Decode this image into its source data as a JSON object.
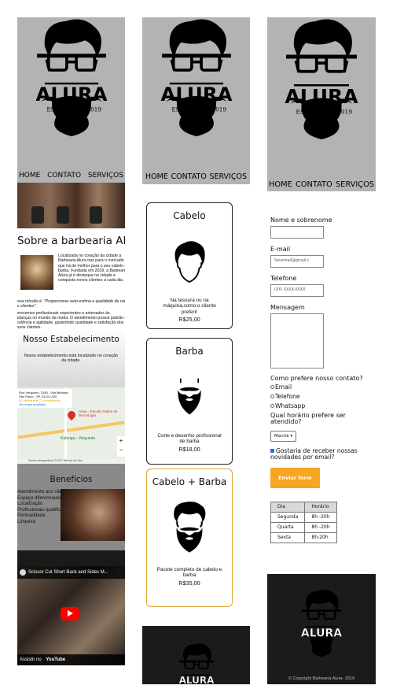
{
  "logo": {
    "brand": "ALURA",
    "estd": "ESTD",
    "year": "2019"
  },
  "nav": {
    "home": "HOME",
    "contato": "CONTATO",
    "servicos": "SERVIÇOS"
  },
  "about": {
    "title": "Sobre a barbearia Alura",
    "p1": "Localizada no coração da cidade a Barbearia Alura traz para o mercado o que há de melhor para o seu cabelo e barba. Fundada em 2019, a Barbearia Alura já é destaque na cidade e conquista novos clientes a cada dia.",
    "mission": "Nossa missão é: \"Proporcionar auto-estima e qualidade de vida aos clientes\".",
    "p2": "Oferecemos profissionais experientes e antenados às mudanças no mundo da moda. O atendimento possui padrão de excelência e agilidade, garantindo qualidade e satisfação dos nossos clientes."
  },
  "establishment": {
    "title": "Nosso Estabelecimento",
    "text": "Nosso estabelecimento está localizado no coração da cidade."
  },
  "map": {
    "address": "Rua Vergueiro, 3185 - Vila Mariana, São Paulo - SP, 04101-300",
    "rating": "5,0 ★★★★★  71 comentários",
    "link": "Ver mapa ampliado",
    "place": "Alura - Escola Online de Tecnologia",
    "station": "Kalunga - Vergueiro",
    "zoom_in": "+",
    "zoom_out": "−",
    "footer": "Dados cartográficos ©2021  Termos de Uso"
  },
  "benefits": {
    "title": "Benefícios",
    "items": [
      "Atendimento aos clientes",
      "Espaço diferenciado",
      "Localização",
      "Profissionais qualificados",
      "Pontualidade",
      "Limpeza"
    ]
  },
  "video": {
    "title": "Scissor Cut Short Back and Sides M...",
    "watch": "Assistir no",
    "platform": "YouTube"
  },
  "services": [
    {
      "name": "Cabelo",
      "desc": "Na tesoura ou na máquina,como o cliente preferir",
      "price": "R$25,00"
    },
    {
      "name": "Barba",
      "desc": "Corte e desenho profissional de barba",
      "price": "R$18,00"
    },
    {
      "name": "Cabelo + Barba",
      "desc": "Pacote completo de cabelo e barba",
      "price": "R$35,00"
    }
  ],
  "form": {
    "name_label": "Nome e sobrenome",
    "email_label": "E-mail",
    "email_placeholder": "Seuemail@gmail.c",
    "phone_label": "Telefone",
    "phone_placeholder": "(XX) XXXX-XXXX",
    "message_label": "Mensagem",
    "contact_question": "Como prefere nosso contato?",
    "contact_options": [
      "Email",
      "Telefone",
      "Whatsapp"
    ],
    "time_question": "Qual horário prefere ser atendido?",
    "time_value": "Manhã",
    "newsletter": "Gostaria de receber nossas novidades por email?",
    "submit": "Enviar form"
  },
  "hours": {
    "header": [
      "Dia",
      "Horário"
    ],
    "rows": [
      [
        "Segunda",
        "8h -20h"
      ],
      [
        "Quarta",
        "8h -20h"
      ],
      [
        "Sexta",
        "8h-20h"
      ]
    ]
  },
  "footer": {
    "copyright": "© Copyright Barbearia Alura- 2019"
  },
  "colors": {
    "header_bg": "#b3b3b3",
    "accent": "#f5a623",
    "footer_bg": "#1b1b1b"
  }
}
